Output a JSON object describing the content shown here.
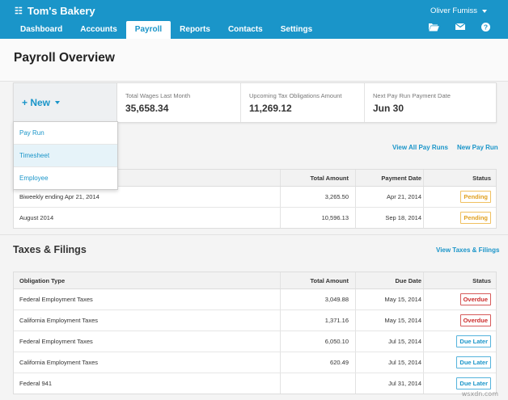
{
  "app": {
    "company": "Tom's Bakery",
    "user_name": "Oliver Fumiss",
    "nav_tabs": [
      "Dashboard",
      "Accounts",
      "Payroll",
      "Reports",
      "Contacts",
      "Settings"
    ],
    "active_tab": "Payroll",
    "top_icons": [
      "folder-icon",
      "mail-icon",
      "help-icon"
    ]
  },
  "page": {
    "title": "Payroll Overview"
  },
  "summary": {
    "new_label": "+ New",
    "stats": [
      {
        "label": "Total Wages Last Month",
        "value": "35,658.34"
      },
      {
        "label": "Upcoming Tax Obligations Amount",
        "value": "11,269.12"
      },
      {
        "label": "Next Pay Run Payment Date",
        "value": "Jun 30"
      }
    ]
  },
  "new_menu": {
    "items": [
      "Pay Run",
      "Timesheet",
      "Employee"
    ],
    "highlighted": "Timesheet"
  },
  "pay_runs": {
    "links": {
      "view_all": "View All Pay Runs",
      "new": "New Pay Run"
    },
    "headers": {
      "amount": "Total Amount",
      "date": "Payment Date",
      "status": "Status"
    },
    "rows": [
      {
        "name": "Biweekly ending Apr 21, 2014",
        "amount": "3,265.50",
        "date": "Apr 21, 2014",
        "status": "Pending"
      },
      {
        "name": "August 2014",
        "amount": "10,596.13",
        "date": "Sep 18, 2014",
        "status": "Pending"
      }
    ]
  },
  "taxes": {
    "title": "Taxes & Filings",
    "link": "View Taxes & Filings",
    "headers": {
      "type": "Obligation Type",
      "amount": "Total Amount",
      "date": "Due Date",
      "status": "Status"
    },
    "rows": [
      {
        "name": "Federal Employment Taxes",
        "amount": "3,049.88",
        "date": "May 15, 2014",
        "status": "Overdue"
      },
      {
        "name": "California Employment Taxes",
        "amount": "1,371.16",
        "date": "May 15, 2014",
        "status": "Overdue"
      },
      {
        "name": "Federal Employment Taxes",
        "amount": "6,050.10",
        "date": "Jul 15, 2014",
        "status": "Due Later"
      },
      {
        "name": "California Employment Taxes",
        "amount": "620.49",
        "date": "Jul 15, 2014",
        "status": "Due Later"
      },
      {
        "name": "Federal 941",
        "amount": "",
        "date": "Jul 31, 2014",
        "status": "Due Later"
      }
    ]
  },
  "watermark": "wsxdn.com",
  "colors": {
    "brand": "#1a95c9",
    "pending": "#e0a020",
    "overdue": "#cc2b2b",
    "later": "#1a95c9"
  }
}
